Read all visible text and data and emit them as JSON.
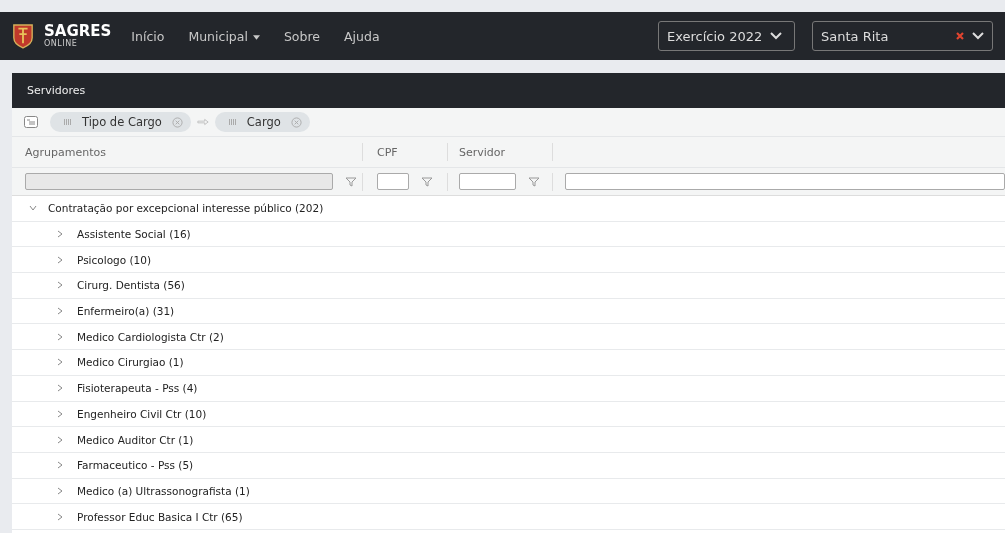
{
  "navbar": {
    "brand": "SAGRES",
    "brand_sub": "O N L I N E",
    "links": [
      {
        "label": "Início",
        "dropdown": false
      },
      {
        "label": "Municipal",
        "dropdown": true
      },
      {
        "label": "Sobre",
        "dropdown": false
      },
      {
        "label": "Ajuda",
        "dropdown": false
      }
    ],
    "year_select": "Exercício 2022",
    "city_select": "Santa Rita"
  },
  "panel": {
    "title": "Servidores",
    "group_chips": [
      "Tipo de Cargo",
      "Cargo"
    ],
    "columns": [
      {
        "label": "Agrupamentos",
        "filter_disabled": true
      },
      {
        "label": "CPF",
        "filter_disabled": false
      },
      {
        "label": "Servidor",
        "filter_disabled": false
      },
      {
        "filter_disabled": false
      }
    ],
    "tree": [
      {
        "label": "Contratação por excepcional interesse público (202)",
        "expanded": true,
        "children": [
          {
            "label": "Assistente Social (16)",
            "expanded": false
          },
          {
            "label": "Psicologo (10)",
            "expanded": false
          },
          {
            "label": "Cirurg. Dentista (56)",
            "expanded": false
          },
          {
            "label": "Enfermeiro(a) (31)",
            "expanded": false
          },
          {
            "label": "Medico Cardiologista Ctr (2)",
            "expanded": false
          },
          {
            "label": "Medico Cirurgiao (1)",
            "expanded": false
          },
          {
            "label": "Fisioterapeuta - Pss (4)",
            "expanded": false
          },
          {
            "label": "Engenheiro Civil Ctr (10)",
            "expanded": false
          },
          {
            "label": "Medico Auditor Ctr (1)",
            "expanded": false
          },
          {
            "label": "Farmaceutico - Pss (5)",
            "expanded": false
          },
          {
            "label": "Medico (a) Ultrassonografista (1)",
            "expanded": false
          },
          {
            "label": "Professor Educ Basica I Ctr (65)",
            "expanded": false
          }
        ]
      }
    ]
  }
}
